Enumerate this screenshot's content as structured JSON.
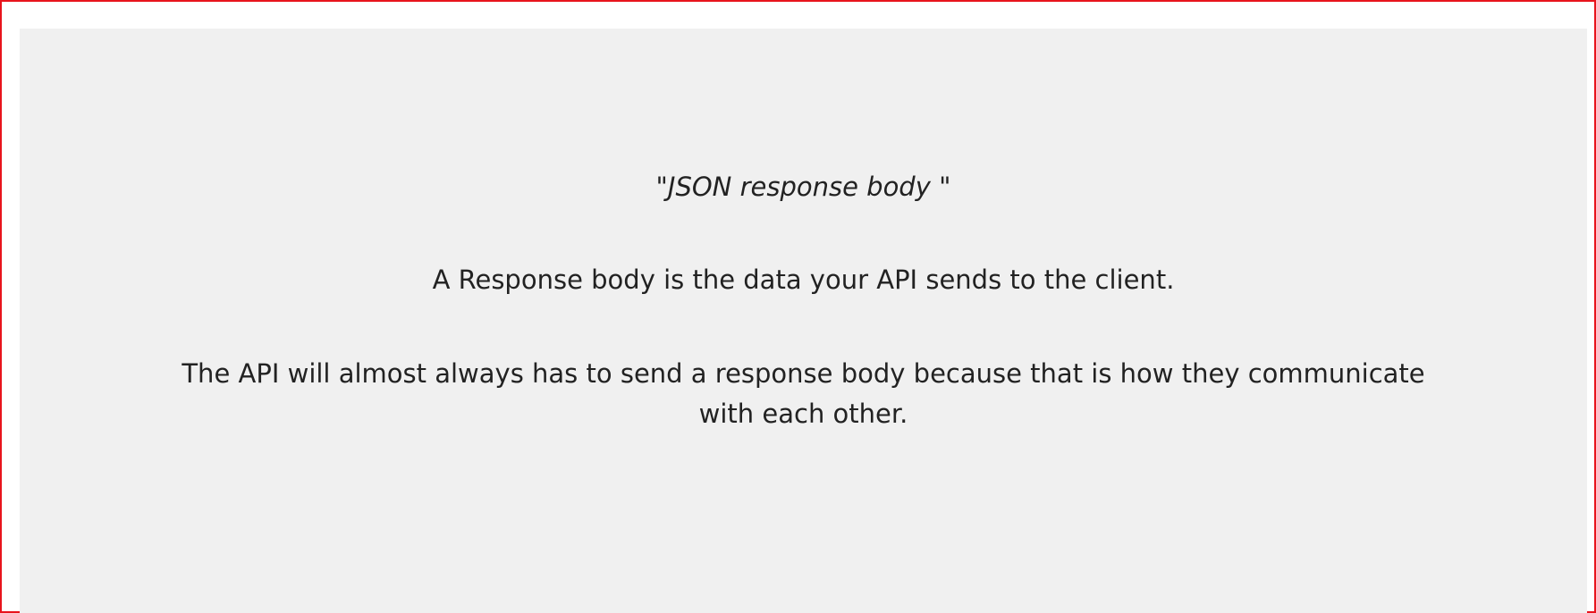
{
  "slide": {
    "title": "\"JSON response body \"",
    "paragraph_1": "A Response body is the data your API sends to the client.",
    "paragraph_2": "The API will almost always has to send a response body because that is how they communicate with each other."
  },
  "colors": {
    "frame_border": "#e8141c",
    "panel_background": "#f0f0f0",
    "text": "#222222"
  }
}
